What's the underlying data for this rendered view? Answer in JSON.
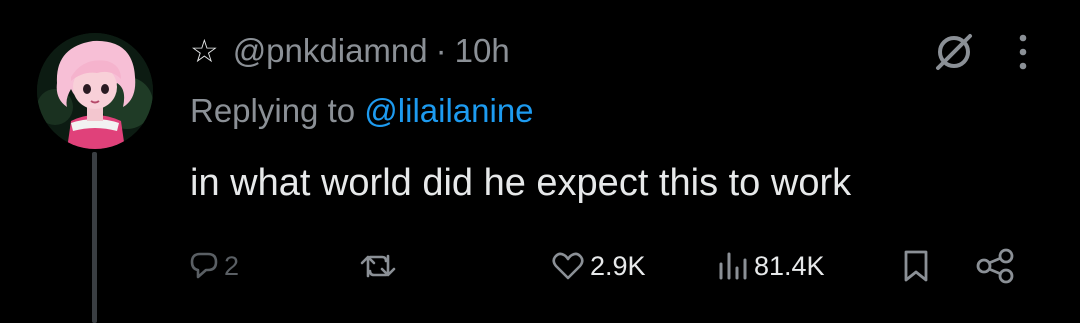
{
  "tweet": {
    "handle": "@pnkdiamnd",
    "separator": "·",
    "time": "10h",
    "replying_prefix": "Replying to",
    "replying_to": "@lilailanine",
    "text": "in what world did he expect this to work",
    "star_icon": "star-icon"
  },
  "actions": {
    "reply_count": "2",
    "retweet_count": "",
    "like_count": "2.9K",
    "views_count": "81.4K"
  },
  "colors": {
    "background": "#000000",
    "text": "#e7e9ea",
    "muted": "#8b9096",
    "mention": "#1d9bf0"
  }
}
